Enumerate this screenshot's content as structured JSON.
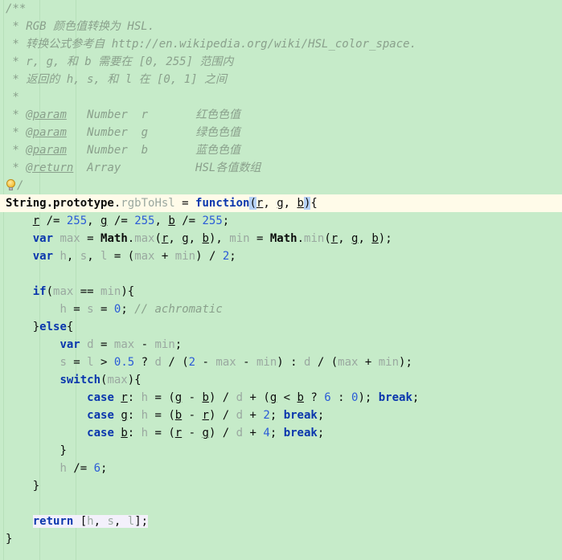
{
  "app": {
    "name": "code-editor",
    "language": "javascript",
    "theme": "light-green"
  },
  "colors": {
    "background": "#c6ebc9",
    "current_line_highlight": "#fffbe9",
    "selection_highlight": "#f3f0fb",
    "comment": "#8aa08c",
    "keyword": "#0a36ad",
    "number": "#2a5bd7",
    "identifier": "#0b0b0b",
    "method": "#9aa8a0",
    "bracket_match": "#b6d1f5",
    "indent_guide": "#b7e0ba"
  },
  "gutter": {
    "intention_bulb_icon": "lightbulb-icon",
    "intention_bulb_line": 12
  },
  "code": {
    "lines": [
      {
        "n": 1,
        "indent": 0,
        "text": "/**"
      },
      {
        "n": 2,
        "indent": 0,
        "text": " * RGB 颜色值转换为 HSL."
      },
      {
        "n": 3,
        "indent": 0,
        "text": " * 转换公式参考自 http://en.wikipedia.org/wiki/HSL_color_space."
      },
      {
        "n": 4,
        "indent": 0,
        "text": " * r, g, 和 b 需要在 [0, 255] 范围内"
      },
      {
        "n": 5,
        "indent": 0,
        "text": " * 返回的 h, s, 和 l 在 [0, 1] 之间"
      },
      {
        "n": 6,
        "indent": 0,
        "text": " *"
      },
      {
        "n": 7,
        "indent": 0,
        "text": " * @param   Number  r       红色色值"
      },
      {
        "n": 8,
        "indent": 0,
        "text": " * @param   Number  g       绿色色值"
      },
      {
        "n": 9,
        "indent": 0,
        "text": " * @param   Number  b       蓝色色值"
      },
      {
        "n": 10,
        "indent": 0,
        "text": " * @return  Array           HSL各值数组"
      },
      {
        "n": 11,
        "indent": 0,
        "text": " */"
      },
      {
        "n": 12,
        "indent": 0,
        "text": "String.prototype.rgbToHsl = function(r, g, b){"
      },
      {
        "n": 13,
        "indent": 1,
        "text": "r /= 255, g /= 255, b /= 255;"
      },
      {
        "n": 14,
        "indent": 1,
        "text": "var max = Math.max(r, g, b), min = Math.min(r, g, b);"
      },
      {
        "n": 15,
        "indent": 1,
        "text": "var h, s, l = (max + min) / 2;"
      },
      {
        "n": 16,
        "indent": 0,
        "text": ""
      },
      {
        "n": 17,
        "indent": 1,
        "text": "if(max == min){"
      },
      {
        "n": 18,
        "indent": 2,
        "text": "h = s = 0; // achromatic"
      },
      {
        "n": 19,
        "indent": 1,
        "text": "}else{"
      },
      {
        "n": 20,
        "indent": 2,
        "text": "var d = max - min;"
      },
      {
        "n": 21,
        "indent": 2,
        "text": "s = l > 0.5 ? d / (2 - max - min) : d / (max + min);"
      },
      {
        "n": 22,
        "indent": 2,
        "text": "switch(max){"
      },
      {
        "n": 23,
        "indent": 3,
        "text": "case r: h = (g - b) / d + (g < b ? 6 : 0); break;"
      },
      {
        "n": 24,
        "indent": 3,
        "text": "case g: h = (b - r) / d + 2; break;"
      },
      {
        "n": 25,
        "indent": 3,
        "text": "case b: h = (r - g) / d + 4; break;"
      },
      {
        "n": 26,
        "indent": 2,
        "text": "}"
      },
      {
        "n": 27,
        "indent": 2,
        "text": "h /= 6;"
      },
      {
        "n": 28,
        "indent": 1,
        "text": "}"
      },
      {
        "n": 29,
        "indent": 0,
        "text": ""
      },
      {
        "n": 30,
        "indent": 1,
        "text": "return [h, s, l];"
      },
      {
        "n": 31,
        "indent": 0,
        "text": "}"
      }
    ],
    "tokens": {
      "doc_open": "/**",
      "doc_close": "/",
      "star": " *",
      "doc_line_2": " RGB 颜色值转换为 HSL.",
      "doc_line_3_pre": " 转换公式参考自 ",
      "doc_line_3_url": "http://en.wikipedia.org/wiki/HSL_color_space.",
      "doc_line_4": " r, g, 和 b 需要在 [0, 255] 范围内",
      "doc_line_5": " 返回的 h, s, 和 l 在 [0, 1] 之间",
      "tag_param": "@param",
      "tag_return": "@return",
      "type_number": "Number",
      "type_array": "Array",
      "p_r": "r",
      "p_g": "g",
      "p_b": "b",
      "desc_r": "红色色值",
      "desc_g": "绿色色值",
      "desc_b": "蓝色色值",
      "desc_return": "HSL各值数组",
      "kw_var": "var",
      "kw_if": "if",
      "kw_else": "else",
      "kw_switch": "switch",
      "kw_case": "case",
      "kw_break": "break",
      "kw_return": "return",
      "kw_function": "function",
      "obj_string": "String.prototype",
      "mth_rgbToHsl": "rgbToHsl",
      "obj_math": "Math",
      "mth_max": "max",
      "mth_min": "min",
      "v_max": "max",
      "v_min": "min",
      "v_h": "h",
      "v_s": "s",
      "v_l": "l",
      "v_d": "d",
      "n_255": "255",
      "n_2": "2",
      "n_0": "0",
      "n_05": "0.5",
      "n_6": "6",
      "n_4": "4",
      "cmt_achromatic": "// achromatic"
    }
  }
}
